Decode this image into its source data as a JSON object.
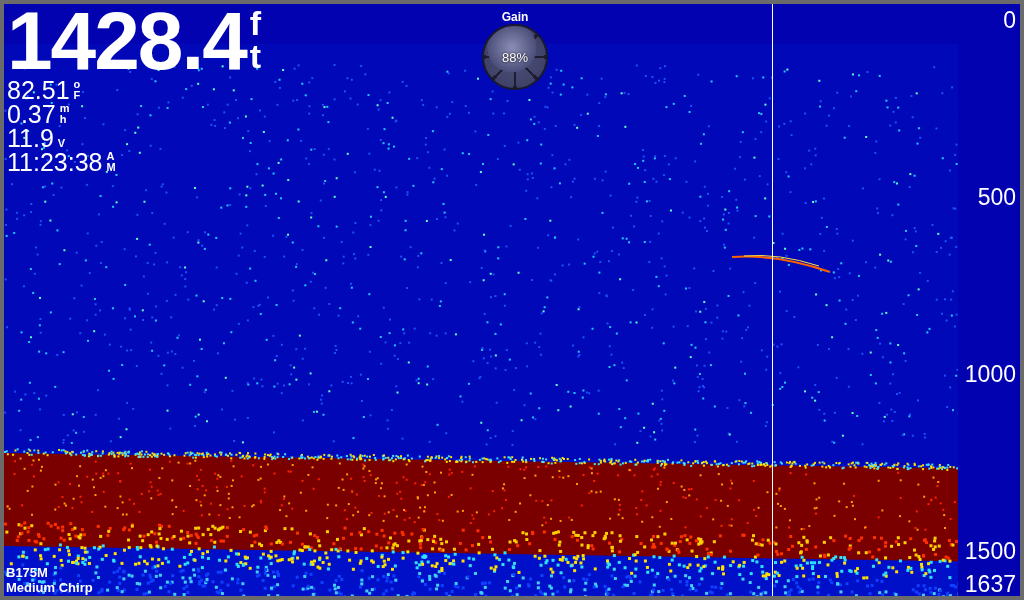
{
  "depth": {
    "value": "1428.4",
    "unit_top": "f",
    "unit_bottom": "t"
  },
  "readings": [
    {
      "value": "82.51",
      "unit_top": "o",
      "unit_bottom": "F"
    },
    {
      "value": "0.37",
      "unit_top": "m",
      "unit_bottom": "h"
    },
    {
      "value": "11.9",
      "unit_bottom": "V"
    },
    {
      "value": "11:23:38",
      "unit_top": "A",
      "unit_bottom": "M"
    }
  ],
  "gain": {
    "label": "Gain",
    "reading": "88%"
  },
  "scale": [
    "0",
    "500",
    "1000",
    "1500",
    "1637"
  ],
  "transducer": "B175M",
  "mode": "Medium Chirp"
}
